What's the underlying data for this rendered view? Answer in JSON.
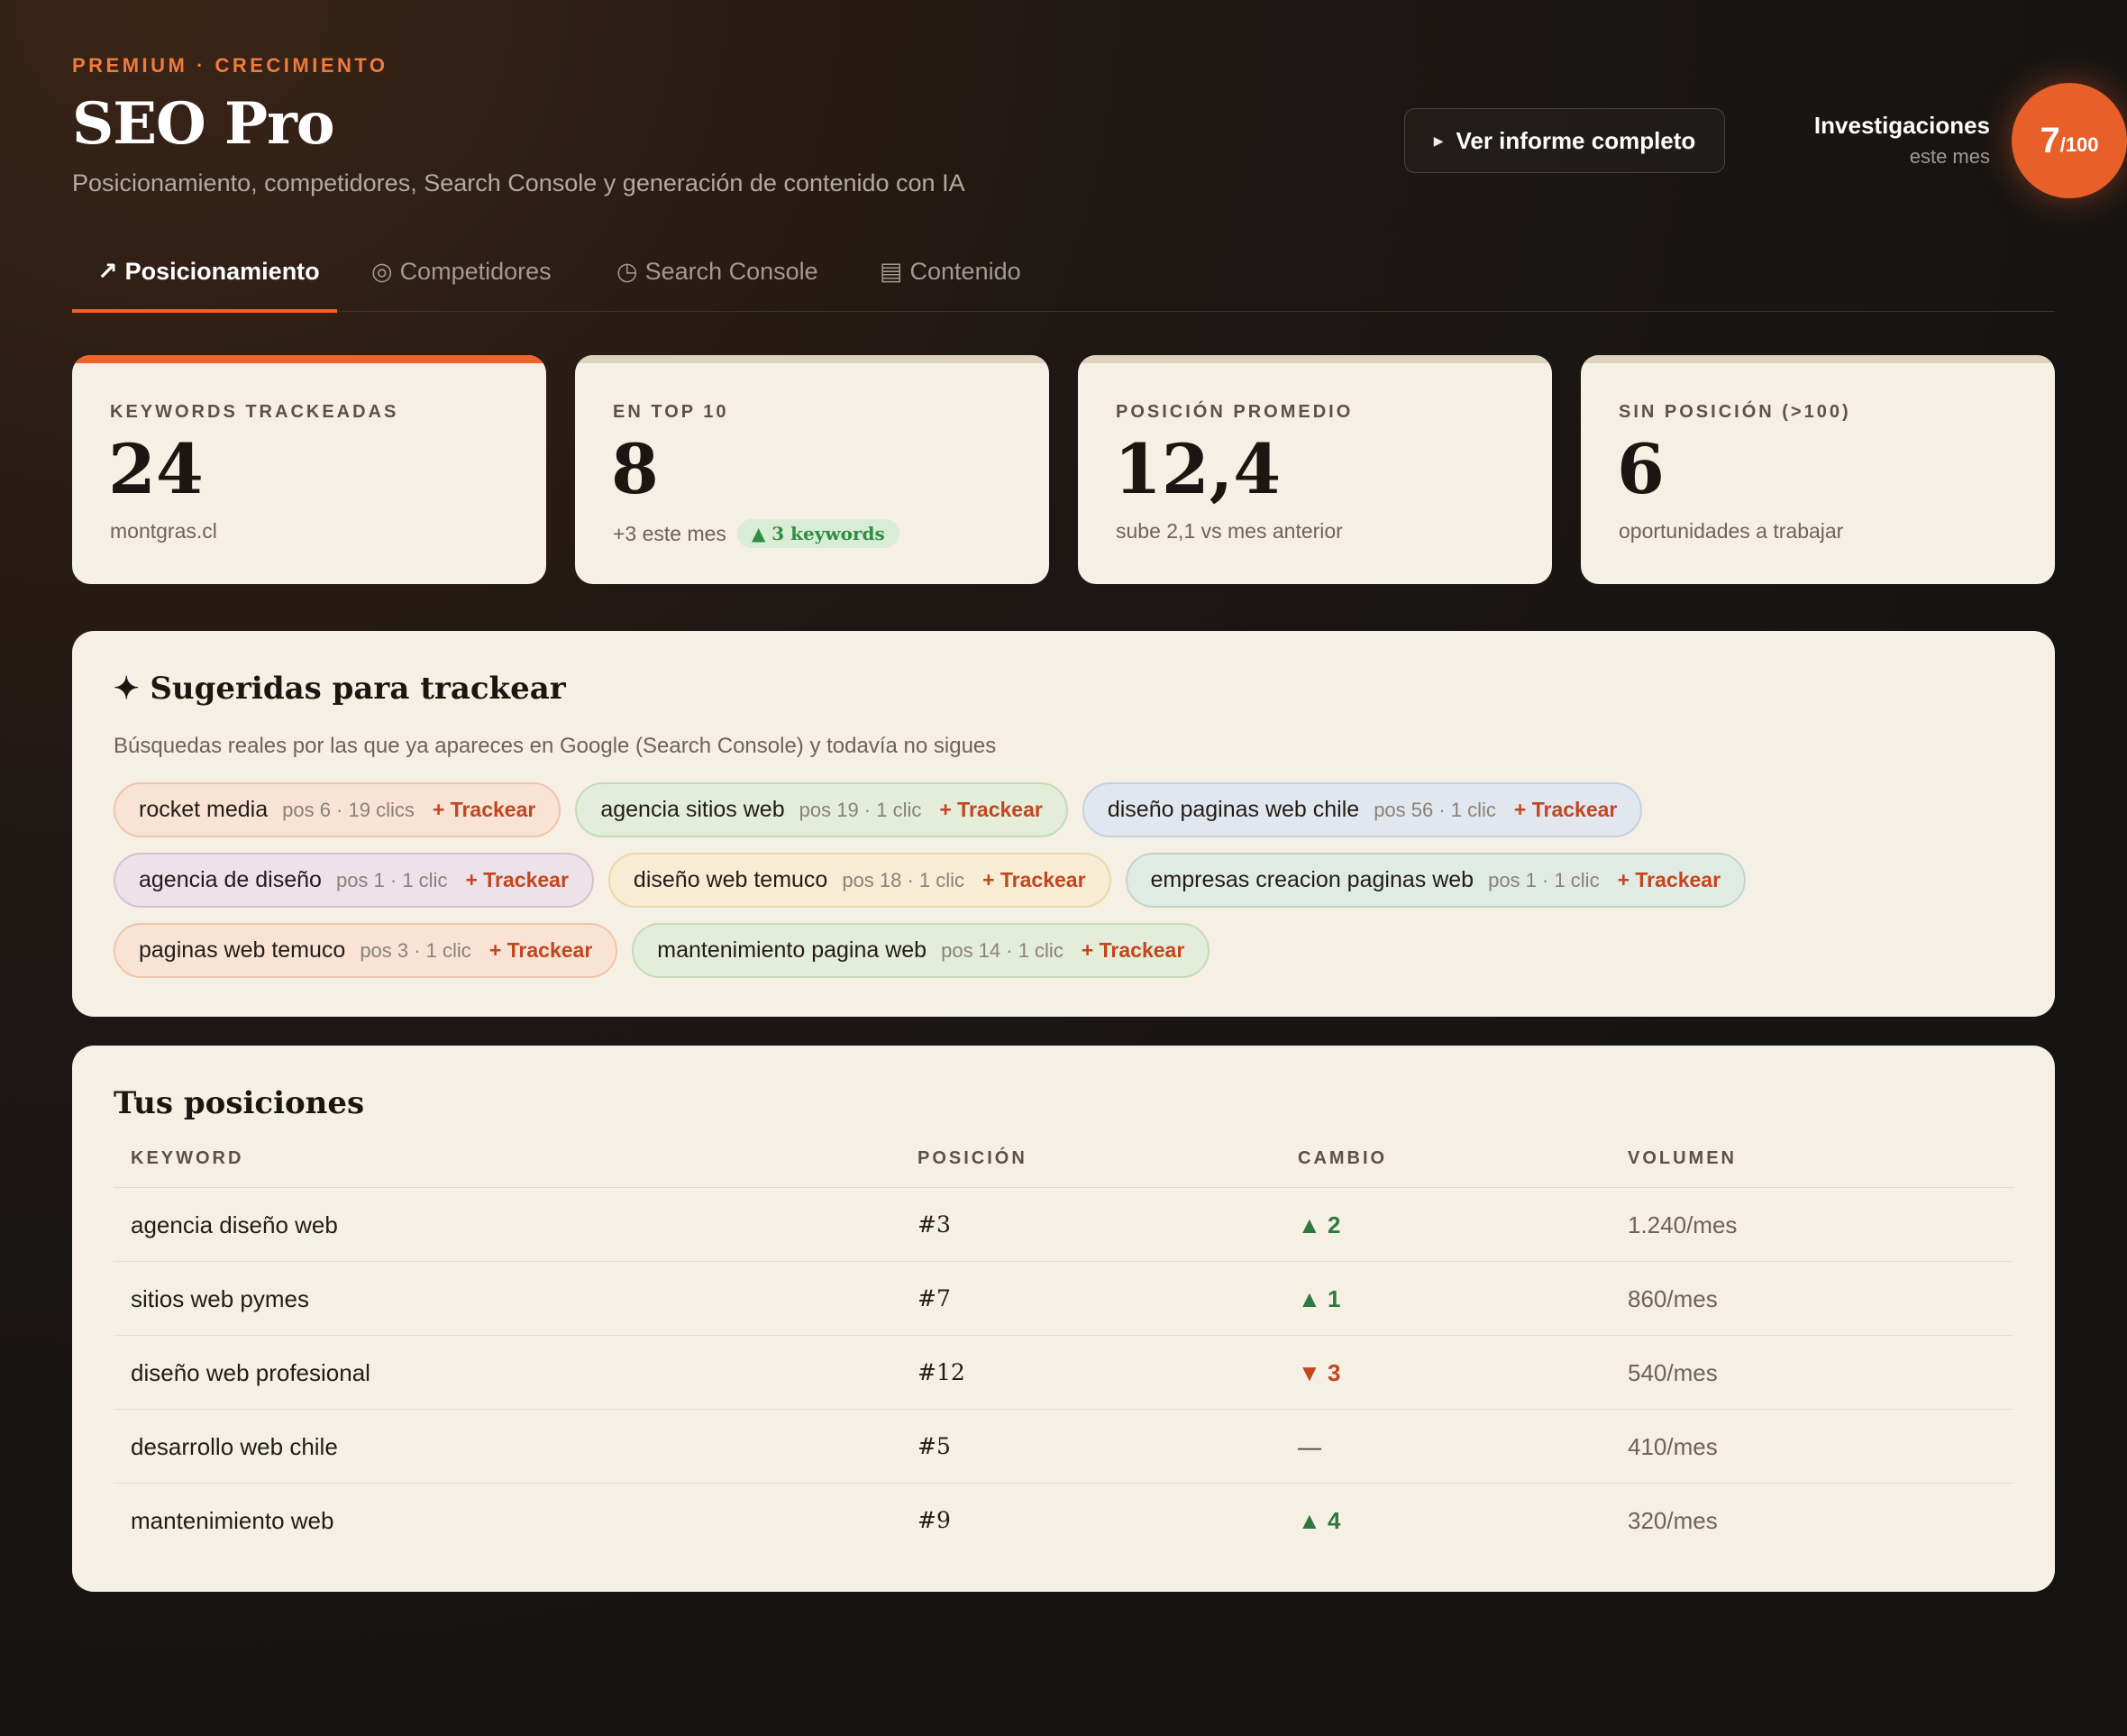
{
  "header": {
    "eyebrow": "PREMIUM · CRECIMIENTO",
    "title": "SEO Pro",
    "subtitle": "Posicionamiento, competidores, Search Console y generación de contenido con IA",
    "report_button": "Ver informe completo",
    "investigations_label": "Investigaciones",
    "investigations_sub": "este mes",
    "counter_used": "7",
    "counter_total": "/100",
    "accent_color": "#e85f2a"
  },
  "tabs": [
    {
      "icon": "↗",
      "label": "Posicionamiento",
      "active": true
    },
    {
      "icon": "◎",
      "label": "Competidores",
      "active": false
    },
    {
      "icon": "◷",
      "label": "Search Console",
      "active": false
    },
    {
      "icon": "▤",
      "label": "Contenido",
      "active": false
    }
  ],
  "stats": [
    {
      "label": "KEYWORDS TRACKEADAS",
      "value": "24",
      "foot": "montgras.cl"
    },
    {
      "label": "EN TOP 10",
      "value": "8",
      "foot": "+3 este mes",
      "badge": "▲ 3 keywords"
    },
    {
      "label": "POSICIÓN PROMEDIO",
      "value": "12,4",
      "foot": "sube 2,1 vs mes anterior"
    },
    {
      "label": "SIN POSICIÓN (>100)",
      "value": "6",
      "foot": "oportunidades a trabajar"
    }
  ],
  "suggested": {
    "title": "✦ Sugeridas para trackear",
    "description": "Búsquedas reales por las que ya apareces en Google (Search Console) y todavía no sigues",
    "action_label": "+ Trackear",
    "chips": [
      {
        "keyword": "rocket media",
        "meta": "pos 6 · 19 clics"
      },
      {
        "keyword": "agencia sitios web",
        "meta": "pos 19 · 1 clic"
      },
      {
        "keyword": "diseño paginas web chile",
        "meta": "pos 56 · 1 clic"
      },
      {
        "keyword": "agencia de diseño",
        "meta": "pos 1 · 1 clic"
      },
      {
        "keyword": "diseño web temuco",
        "meta": "pos 18 · 1 clic"
      },
      {
        "keyword": "empresas creacion paginas web",
        "meta": "pos 1 · 1 clic"
      },
      {
        "keyword": "paginas web temuco",
        "meta": "pos 3 · 1 clic"
      },
      {
        "keyword": "mantenimiento pagina web",
        "meta": "pos 14 · 1 clic"
      }
    ]
  },
  "positions": {
    "title": "Tus posiciones",
    "columns": [
      "KEYWORD",
      "POSICIÓN",
      "CAMBIO",
      "VOLUMEN"
    ],
    "rows": [
      {
        "keyword": "agencia diseño web",
        "position": "#3",
        "change": "▲ 2",
        "trend": "up",
        "volume": "1.240/mes"
      },
      {
        "keyword": "sitios web pymes",
        "position": "#7",
        "change": "▲ 1",
        "trend": "up",
        "volume": "860/mes"
      },
      {
        "keyword": "diseño web profesional",
        "position": "#12",
        "change": "▼ 3",
        "trend": "down",
        "volume": "540/mes"
      },
      {
        "keyword": "desarrollo web chile",
        "position": "#5",
        "change": "—",
        "trend": "flat",
        "volume": "410/mes"
      },
      {
        "keyword": "mantenimiento web",
        "position": "#9",
        "change": "▲ 4",
        "trend": "up",
        "volume": "320/mes"
      }
    ]
  }
}
